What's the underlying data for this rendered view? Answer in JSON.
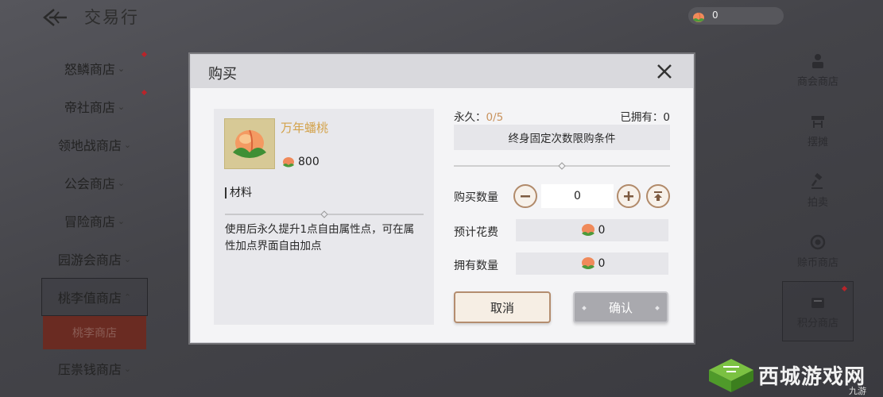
{
  "header": {
    "title": "交易行",
    "currency_value": "0"
  },
  "left_nav": {
    "items": [
      {
        "label": "怒鳞商店",
        "caret": "⌄",
        "badge": true
      },
      {
        "label": "帝社商店",
        "caret": "⌄",
        "badge": true
      },
      {
        "label": "领地战商店",
        "caret": "⌄",
        "badge": false
      },
      {
        "label": "公会商店",
        "caret": "⌄",
        "badge": false
      },
      {
        "label": "冒险商店",
        "caret": "⌄",
        "badge": false
      },
      {
        "label": "园游会商店",
        "caret": "⌄",
        "badge": false
      },
      {
        "label": "桃李值商店",
        "caret": "⌃",
        "badge": false,
        "active": true
      },
      {
        "label": "压祟钱商店",
        "caret": "⌄",
        "badge": false
      }
    ],
    "subitem": "桃李商店"
  },
  "right_nav": {
    "items": [
      {
        "label": "商会商店",
        "icon": "merchant-icon"
      },
      {
        "label": "摆摊",
        "icon": "stall-icon"
      },
      {
        "label": "拍卖",
        "icon": "gavel-icon"
      },
      {
        "label": "赊币商店",
        "icon": "coin-icon"
      },
      {
        "label": "积分商店",
        "icon": "points-icon",
        "active": true,
        "badge": true
      }
    ]
  },
  "modal": {
    "title": "购买",
    "item": {
      "name": "万年蟠桃",
      "price": "800",
      "category": "材料",
      "description": "使用后永久提升1点自由属性点，可在属性加点界面自由加点"
    },
    "limit": {
      "label": "永久：",
      "value": "0/5",
      "owned_label": "已拥有：",
      "owned_value": "0"
    },
    "condition_button": "终身固定次数限购条件",
    "quantity": {
      "label": "购买数量",
      "value": "0"
    },
    "estimated_cost": {
      "label": "预计花费",
      "value": "0"
    },
    "owned_amount": {
      "label": "拥有数量",
      "value": "0"
    },
    "cancel_label": "取消",
    "confirm_label": "确认"
  },
  "watermark": {
    "text": "西城游戏网",
    "sub": "九游"
  },
  "colors": {
    "accent_gold": "#d3a24a",
    "limit_value": "#c8925c",
    "badge_red": "#b8242a",
    "button_border": "#b48d6f"
  }
}
